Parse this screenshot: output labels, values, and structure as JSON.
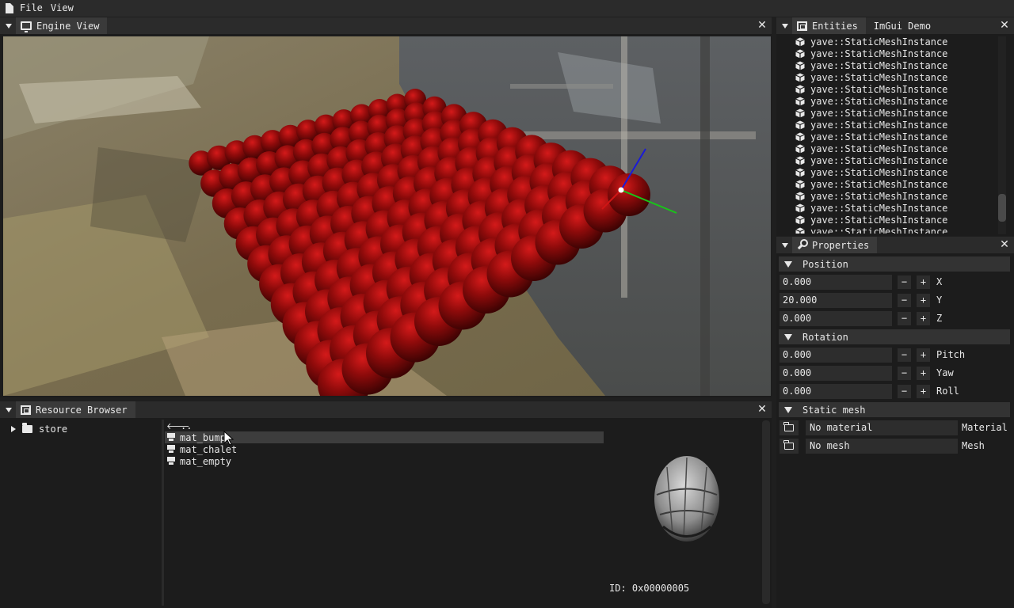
{
  "menu": {
    "items": [
      "File",
      "View"
    ]
  },
  "engine_view": {
    "title": "Engine View"
  },
  "entities": {
    "tabs": [
      "Entities",
      "ImGui Demo"
    ],
    "items": [
      "yave::StaticMeshInstance",
      "yave::StaticMeshInstance",
      "yave::StaticMeshInstance",
      "yave::StaticMeshInstance",
      "yave::StaticMeshInstance",
      "yave::StaticMeshInstance",
      "yave::StaticMeshInstance",
      "yave::StaticMeshInstance",
      "yave::StaticMeshInstance",
      "yave::StaticMeshInstance",
      "yave::StaticMeshInstance",
      "yave::StaticMeshInstance",
      "yave::StaticMeshInstance",
      "yave::StaticMeshInstance",
      "yave::StaticMeshInstance",
      "yave::StaticMeshInstance",
      "yave::StaticMeshInstance"
    ]
  },
  "properties": {
    "title": "Properties",
    "position": {
      "header": "Position",
      "rows": [
        {
          "value": "0.000",
          "label": "X"
        },
        {
          "value": "20.000",
          "label": "Y"
        },
        {
          "value": "0.000",
          "label": "Z"
        }
      ]
    },
    "rotation": {
      "header": "Rotation",
      "rows": [
        {
          "value": "0.000",
          "label": "Pitch"
        },
        {
          "value": "0.000",
          "label": "Yaw"
        },
        {
          "value": "0.000",
          "label": "Roll"
        }
      ]
    },
    "static_mesh": {
      "header": "Static mesh",
      "material_value": "No material",
      "material_label": "Material",
      "mesh_value": "No mesh",
      "mesh_label": "Mesh"
    },
    "minus": "−",
    "plus": "+"
  },
  "resource_browser": {
    "title": "Resource Browser",
    "tree": [
      {
        "label": "store"
      }
    ],
    "parent": "..",
    "files": [
      "mat_bump",
      "mat_chalet",
      "mat_empty"
    ],
    "selected_index": 0,
    "preview_id": "ID: 0x00000005"
  },
  "colors": {
    "sphere": "#8a0a0a",
    "gizmo_x": "#d01515",
    "gizmo_y": "#19c419",
    "gizmo_z": "#1a1ad8"
  }
}
